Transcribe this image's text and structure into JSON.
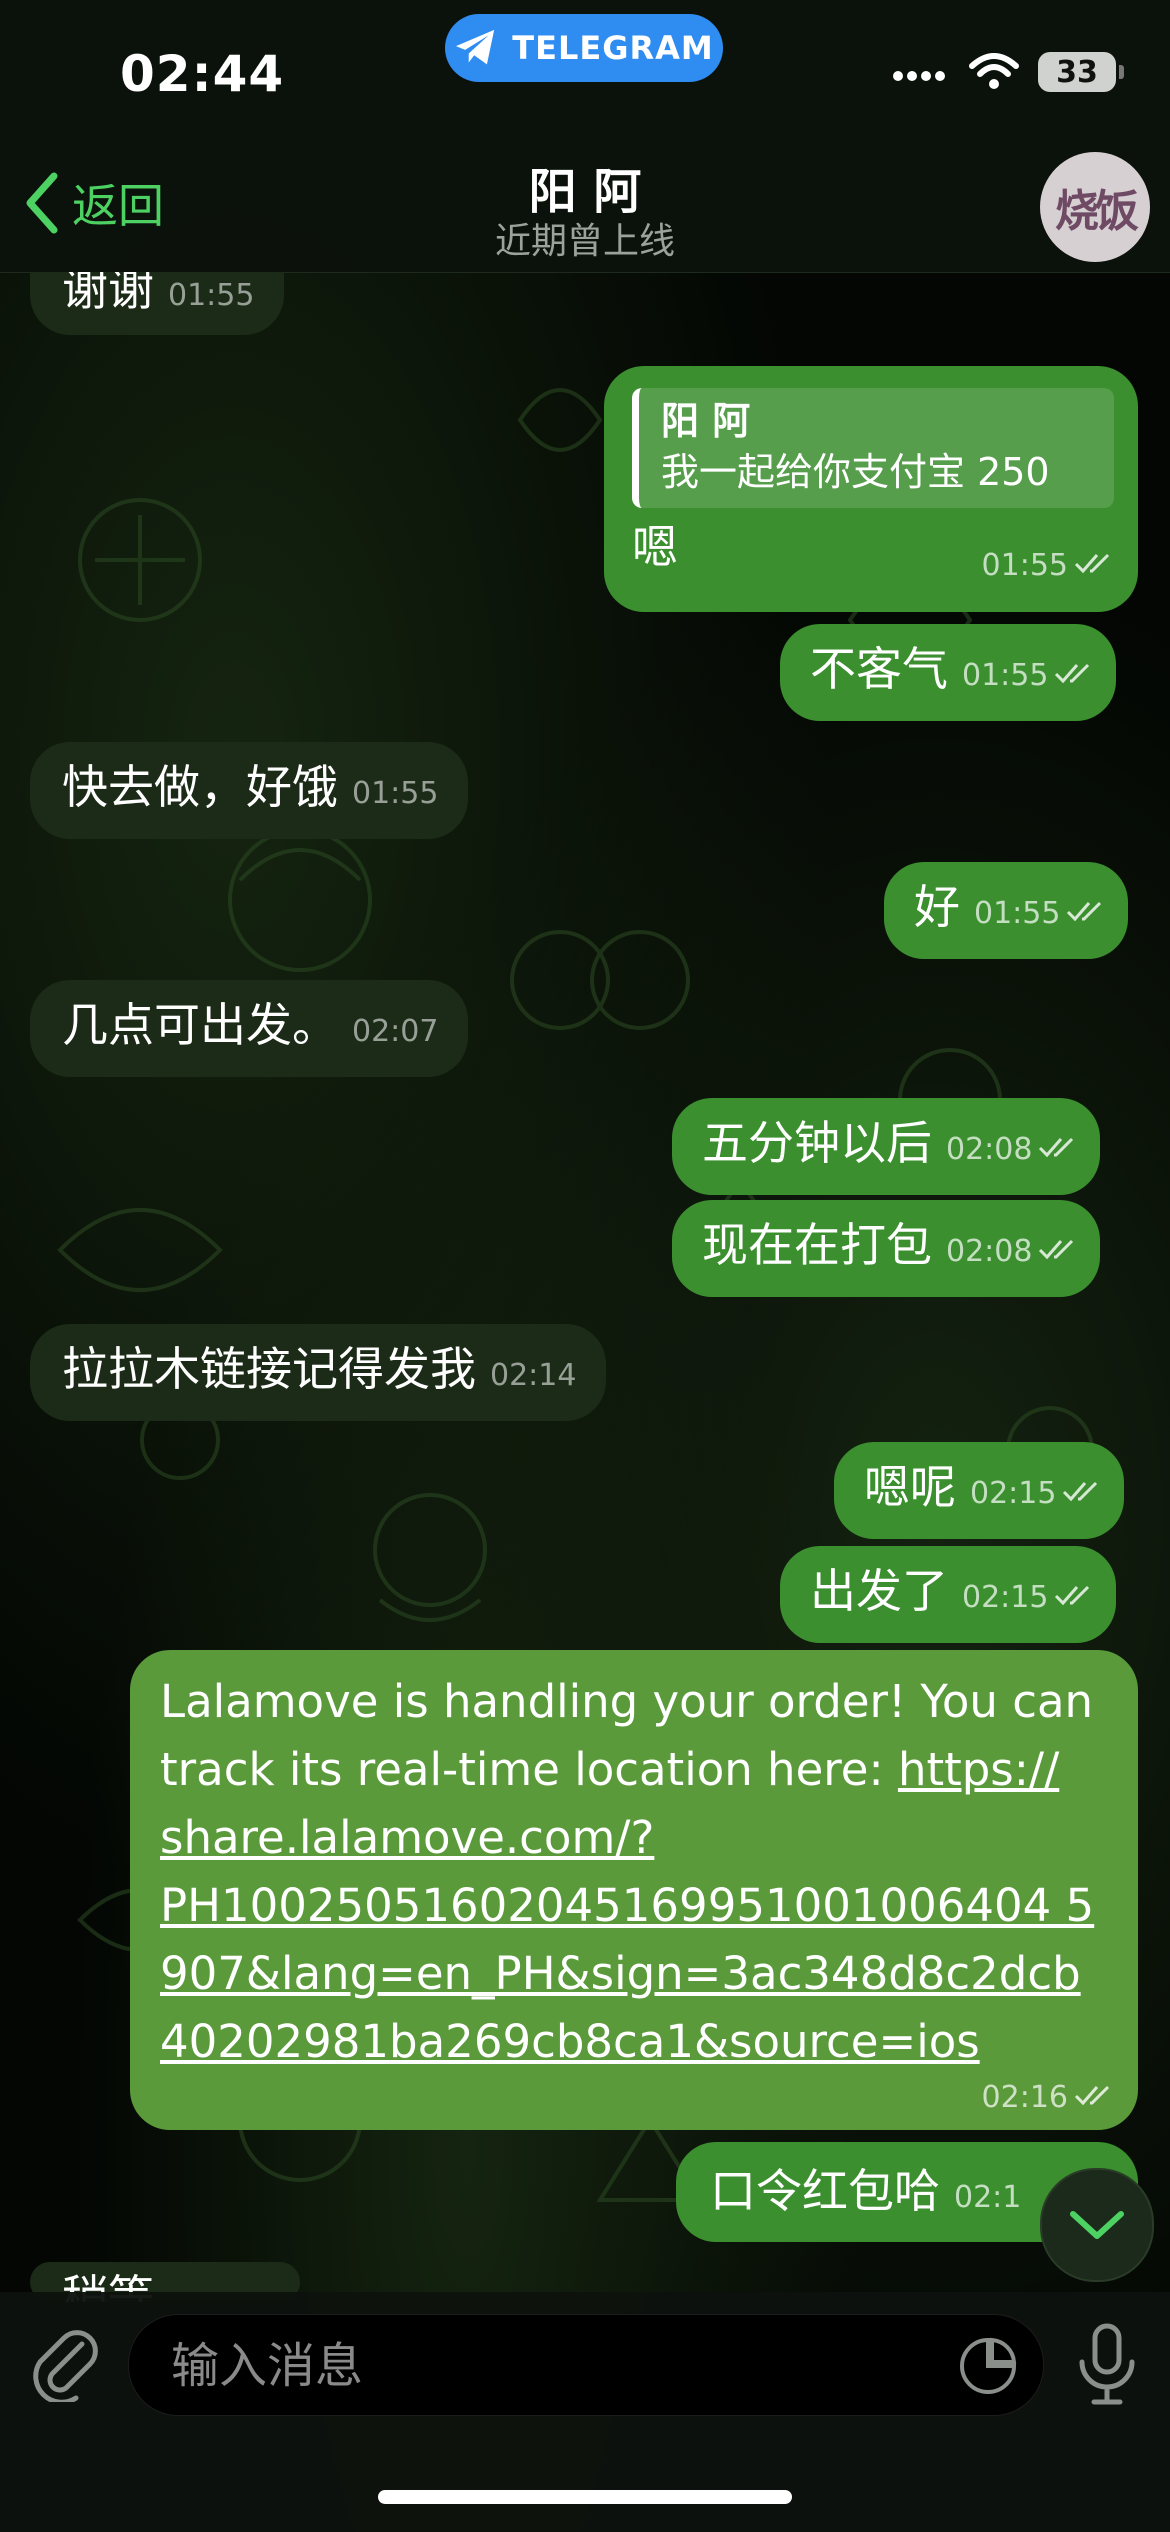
{
  "status": {
    "time": "02:44",
    "app_pill": "TELEGRAM",
    "battery": "33"
  },
  "header": {
    "back_label": "返回",
    "title": "阳 阿",
    "subtitle": "近期曾上线",
    "avatar_text": "烧饭"
  },
  "messages": [
    {
      "dir": "in",
      "text": "谢谢",
      "time": "01:55"
    },
    {
      "dir": "out",
      "reply_name": "阳 阿",
      "reply_text": "我一起给你支付宝 250",
      "text": "嗯",
      "time": "01:55"
    },
    {
      "dir": "out",
      "text": "不客气",
      "time": "01:55"
    },
    {
      "dir": "in",
      "text": "快去做，好饿",
      "time": "01:55"
    },
    {
      "dir": "out",
      "text": "好",
      "time": "01:55"
    },
    {
      "dir": "in",
      "text": "几点可出发。",
      "time": "02:07"
    },
    {
      "dir": "out",
      "text": "五分钟以后",
      "time": "02:08"
    },
    {
      "dir": "out",
      "text": "现在在打包",
      "time": "02:08"
    },
    {
      "dir": "in",
      "text": "拉拉木链接记得发我",
      "time": "02:14"
    },
    {
      "dir": "out",
      "text": "嗯呢",
      "time": "02:15"
    },
    {
      "dir": "out",
      "text": "出发了",
      "time": "02:15"
    },
    {
      "dir": "out",
      "text_prefix": "Lalamove is handling your order! You can track its real-time location here: ",
      "link_lines": [
        "https://",
        "share.lalamove.com/?",
        "PH10025051602045169951001006404 5",
        "907&lang=en_PH&sign=3ac348d8c2dcb",
        "40202981ba269cb8ca1&source=ios"
      ],
      "time": "02:16"
    },
    {
      "dir": "out",
      "text": "口令红包哈",
      "time": "02:1"
    },
    {
      "dir": "in",
      "text": "稍等"
    }
  ],
  "input": {
    "placeholder": "输入消息"
  },
  "colors": {
    "accent": "#4ed163",
    "out_bubble": "#3b8f2f",
    "in_bubble": "#1b2b17",
    "telegram_blue": "#2f8cf0"
  },
  "icons": [
    "telegram-icon",
    "signal-icon",
    "wifi-icon",
    "chevron-left-icon",
    "read-ticks-icon",
    "chevron-down-icon",
    "paperclip-icon",
    "sticker-icon",
    "microphone-icon"
  ]
}
